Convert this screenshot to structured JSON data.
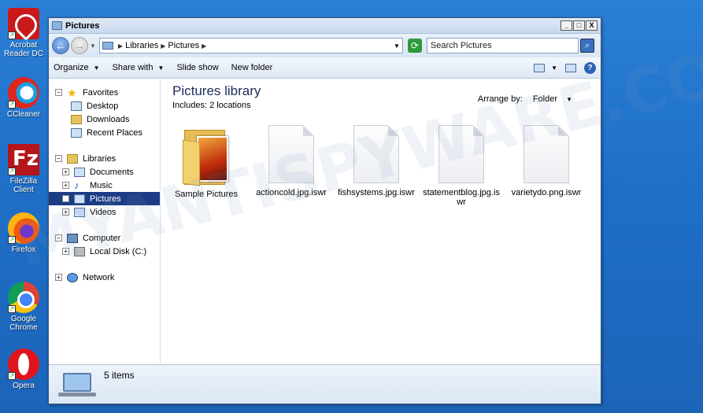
{
  "desktop": {
    "icons": [
      {
        "label_line1": "Acrobat",
        "label_line2": "Reader DC"
      },
      {
        "label_line1": "CCleaner",
        "label_line2": ""
      },
      {
        "label_line1": "FileZilla Client",
        "label_line2": ""
      },
      {
        "label_line1": "Firefox",
        "label_line2": ""
      },
      {
        "label_line1": "Google",
        "label_line2": "Chrome"
      },
      {
        "label_line1": "Opera",
        "label_line2": ""
      }
    ],
    "filezilla_glyph": "Fz"
  },
  "window": {
    "title": "Pictures",
    "buttons": {
      "minimize": "_",
      "maximize": "□",
      "close": "X"
    }
  },
  "address": {
    "crumbs": [
      "Libraries",
      "Pictures"
    ],
    "search_placeholder": "Search Pictures"
  },
  "toolbar": {
    "organize": "Organize",
    "share_with": "Share with",
    "slide_show": "Slide show",
    "new_folder": "New folder",
    "help": "?"
  },
  "nav": {
    "favorites": "Favorites",
    "desktop": "Desktop",
    "downloads": "Downloads",
    "recent_places": "Recent Places",
    "libraries": "Libraries",
    "documents": "Documents",
    "music": "Music",
    "pictures": "Pictures",
    "videos": "Videos",
    "computer": "Computer",
    "local_disk": "Local Disk (C:)",
    "network": "Network"
  },
  "content": {
    "title": "Pictures library",
    "includes": "Includes:  2 locations",
    "arrange_label": "Arrange by:",
    "arrange_value": "Folder",
    "files": [
      "Sample Pictures",
      "actioncold.jpg.iswr",
      "fishsystems.jpg.iswr",
      "statementblog.jpg.iswr",
      "varietydo.png.iswr"
    ]
  },
  "details": {
    "count": "5 items"
  },
  "watermark": "MYANTISPYWARE.COM",
  "colors": {
    "desktop": "#1e6fc8",
    "selection": "#1c3d85"
  }
}
